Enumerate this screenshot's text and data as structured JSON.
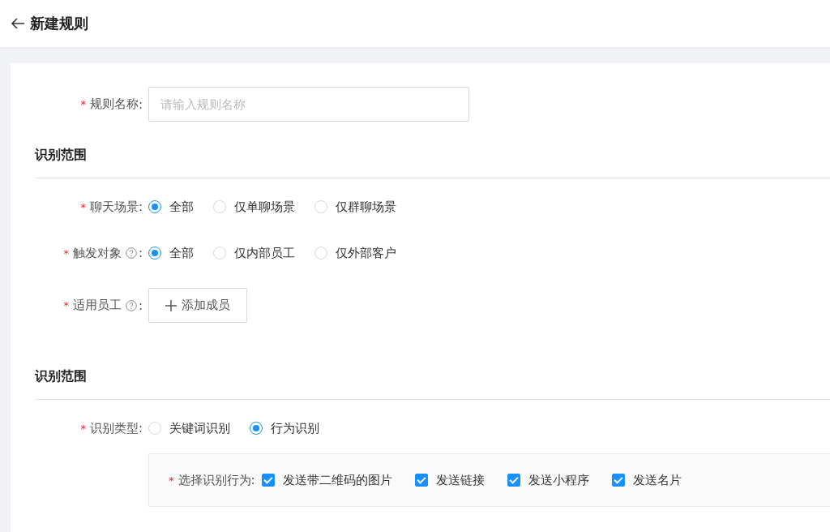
{
  "header": {
    "title": "新建规则"
  },
  "name_row": {
    "required_mark": "*",
    "label": "规则名称",
    "colon": ":",
    "placeholder": "请输入规则名称"
  },
  "sections": [
    {
      "title": "识别范围",
      "rows": [
        {
          "kind": "radio",
          "required_mark": "*",
          "label": "聊天场景",
          "help": false,
          "colon": ":",
          "options": [
            {
              "label": "全部",
              "selected": true
            },
            {
              "label": "仅单聊场景",
              "selected": false
            },
            {
              "label": "仅群聊场景",
              "selected": false
            }
          ]
        },
        {
          "kind": "radio",
          "required_mark": "*",
          "label": "触发对象",
          "help": true,
          "colon": ":",
          "options": [
            {
              "label": "全部",
              "selected": true
            },
            {
              "label": "仅内部员工",
              "selected": false
            },
            {
              "label": "仅外部客户",
              "selected": false
            }
          ]
        },
        {
          "kind": "button",
          "required_mark": "*",
          "label": "适用员工",
          "help": true,
          "colon": ":",
          "button": "添加成员"
        }
      ]
    },
    {
      "title": "识别范围",
      "rows": [
        {
          "kind": "radio",
          "required_mark": "*",
          "label": "识别类型",
          "help": false,
          "colon": ":",
          "options": [
            {
              "label": "关键词识别",
              "selected": false
            },
            {
              "label": "行为识别",
              "selected": true
            }
          ]
        }
      ],
      "panel": {
        "required_mark": "*",
        "label": "选择识别行为",
        "colon": ":",
        "options": [
          {
            "label": "发送带二维码的图片",
            "checked": true
          },
          {
            "label": "发送链接",
            "checked": true
          },
          {
            "label": "发送小程序",
            "checked": true
          },
          {
            "label": "发送名片",
            "checked": true
          }
        ]
      }
    }
  ]
}
